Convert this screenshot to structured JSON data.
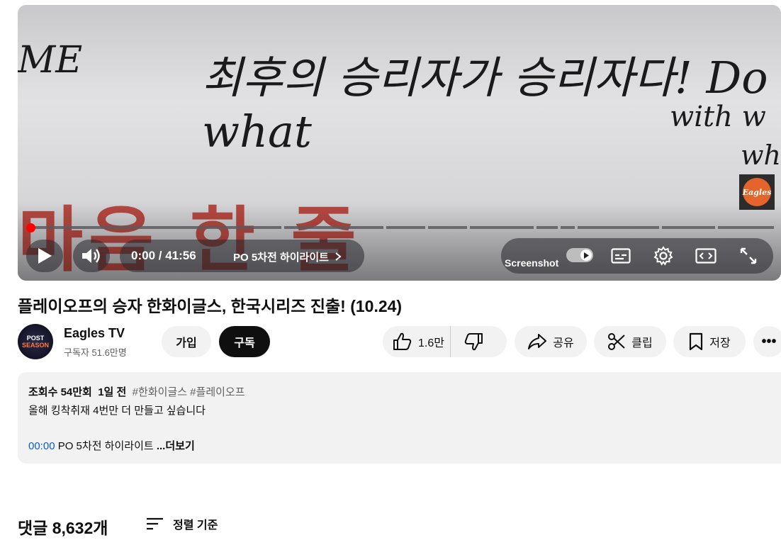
{
  "player": {
    "overlay_text": {
      "line_left": "ME",
      "line_main": "최후의 승리자가 승리자다! Do what",
      "line_right1": "with w",
      "line_right2": "wh",
      "red_caption": "마음 한 줄"
    },
    "watermark_text": "Eagles",
    "progress_fraction": 0.0,
    "time_display": "0:00 / 41:56",
    "chapter_label": "PO 5차전 하이라이트",
    "screenshot_label": "Screenshot",
    "accent_color": "#ff0000"
  },
  "video": {
    "title": "플레이오프의 승자 한화이글스, 한국시리즈 진출! (10.24)"
  },
  "channel": {
    "avatar_text_top": "POST",
    "avatar_text_bottom": "SEASON",
    "name": "Eagles TV",
    "subscribers": "구독자 51.6만명",
    "join_label": "가입",
    "subscribe_label": "구독"
  },
  "actions": {
    "like_count": "1.6만",
    "share_label": "공유",
    "clip_label": "클립",
    "save_label": "저장",
    "more_label": "•••"
  },
  "description": {
    "views": "조회수 54만회",
    "date": "1일 전",
    "tags": "#한화이글스 #플레이오프",
    "line1": "올해 킹착취재 4번만 더 만들고 싶습니다",
    "timestamp": "00:00",
    "timestamp_label": "PO 5차전 하이라이트",
    "more_label": "...더보기"
  },
  "comments": {
    "count_label": "댓글 8,632개",
    "sort_label": "정렬 기준"
  }
}
